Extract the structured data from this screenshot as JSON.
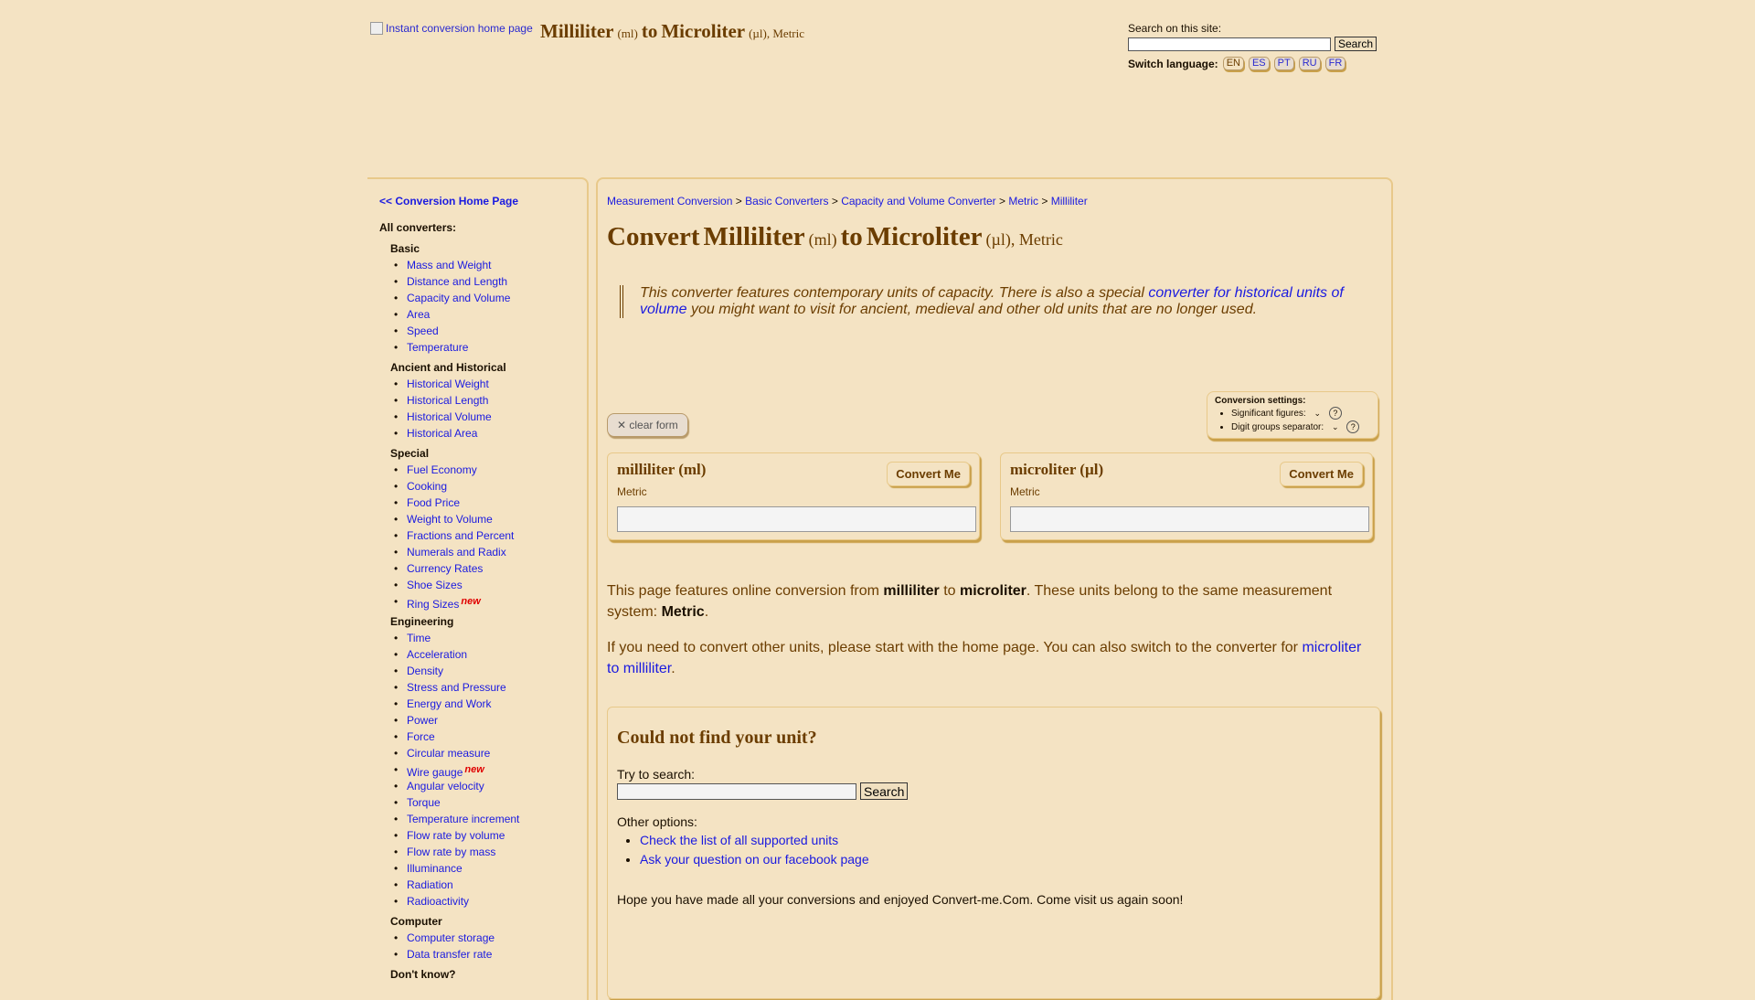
{
  "header": {
    "logo_alt": "Instant conversion home page",
    "title_from": "Milliliter",
    "title_from_abbr": "(ml)",
    "title_to_word": "to",
    "title_to": "Microliter",
    "title_to_abbr": "(µl)",
    "title_system": ", Metric",
    "search_label": "Search on this site:",
    "search_value": "",
    "search_button": "Search",
    "lang_label": "Switch language:",
    "languages": [
      "EN",
      "ES",
      "PT",
      "RU",
      "FR"
    ],
    "active_language": "EN"
  },
  "sidebar": {
    "home_link": "<< Conversion Home Page",
    "all_converters": "All converters:",
    "new_badge": "new",
    "categories": [
      {
        "name": "Basic",
        "items": [
          "Mass and Weight",
          "Distance and Length",
          "Capacity and Volume",
          "Area",
          "Speed",
          "Temperature"
        ]
      },
      {
        "name": "Ancient and Historical",
        "items": [
          "Historical Weight",
          "Historical Length",
          "Historical Volume",
          "Historical Area"
        ]
      },
      {
        "name": "Special",
        "items": [
          "Fuel Economy",
          "Cooking",
          "Food Price",
          "Weight to Volume",
          "Fractions and Percent",
          "Numerals and Radix",
          "Currency Rates",
          "Shoe Sizes",
          "Ring Sizes"
        ]
      },
      {
        "name": "Engineering",
        "items": [
          "Time",
          "Acceleration",
          "Density",
          "Stress and Pressure",
          "Energy and Work",
          "Power",
          "Force",
          "Circular measure",
          "Wire gauge",
          "Angular velocity",
          "Torque",
          "Temperature increment",
          "Flow rate by volume",
          "Flow rate by mass",
          "Illuminance",
          "Radiation",
          "Radioactivity"
        ]
      },
      {
        "name": "Computer",
        "items": [
          "Computer storage",
          "Data transfer rate"
        ]
      },
      {
        "name": "Don't know?",
        "items": []
      }
    ]
  },
  "breadcrumb": {
    "items": [
      "Measurement Conversion",
      "Basic Converters",
      "Capacity and Volume Converter",
      "Metric",
      "Milliliter"
    ],
    "separator": ">"
  },
  "page_title": {
    "prefix": "Convert",
    "from": "Milliliter",
    "from_abbr": "(ml)",
    "to_word": "to",
    "to": "Microliter",
    "to_abbr": "(µl)",
    "system": ", Metric"
  },
  "intro_note": {
    "before": "This converter features contemporary units of capacity. There is also a special ",
    "link": "converter for historical units of volume",
    "after": " you might want to visit for ancient, medieval and other old units that are no longer used."
  },
  "clear_form": "✕ clear form",
  "settings": {
    "heading": "Conversion settings:",
    "sig_figs_label": "Significant figures:",
    "sig_figs_value": "",
    "digit_sep_label": "Digit groups separator:",
    "digit_sep_value": "",
    "help": "?"
  },
  "from_unit": {
    "name": "milliliter (ml)",
    "system": "Metric",
    "value": "",
    "button": "Convert Me"
  },
  "to_unit": {
    "name": "microliter (µl)",
    "system": "Metric",
    "value": "",
    "button": "Convert Me"
  },
  "description": {
    "p1_a": "This page features online conversion from ",
    "p1_from": "milliliter",
    "p1_b": " to ",
    "p1_to": "microliter",
    "p1_c": ". These units belong to the same measurement system: ",
    "p1_sys": "Metric",
    "p1_d": ".",
    "p2_a": "If you need to convert other units, please start with the home page. You can also switch to the converter for ",
    "p2_link": "microliter to milliliter",
    "p2_b": "."
  },
  "not_found": {
    "heading": "Could not find your unit?",
    "try_label": "Try to search:",
    "search_value": "",
    "search_button": "Search",
    "other_options": "Other options:",
    "options": [
      "Check the list of all supported units",
      "Ask your question on our facebook page"
    ],
    "goodbye": "Hope you have made all your conversions and enjoyed Convert-me.Com. Come visit us again soon!"
  },
  "colors": {
    "background": "#f4e3c3",
    "heading": "#6b3d00",
    "link": "#1a1ae0",
    "accent_border": "#e8c98a",
    "new_badge": "#e00000"
  }
}
